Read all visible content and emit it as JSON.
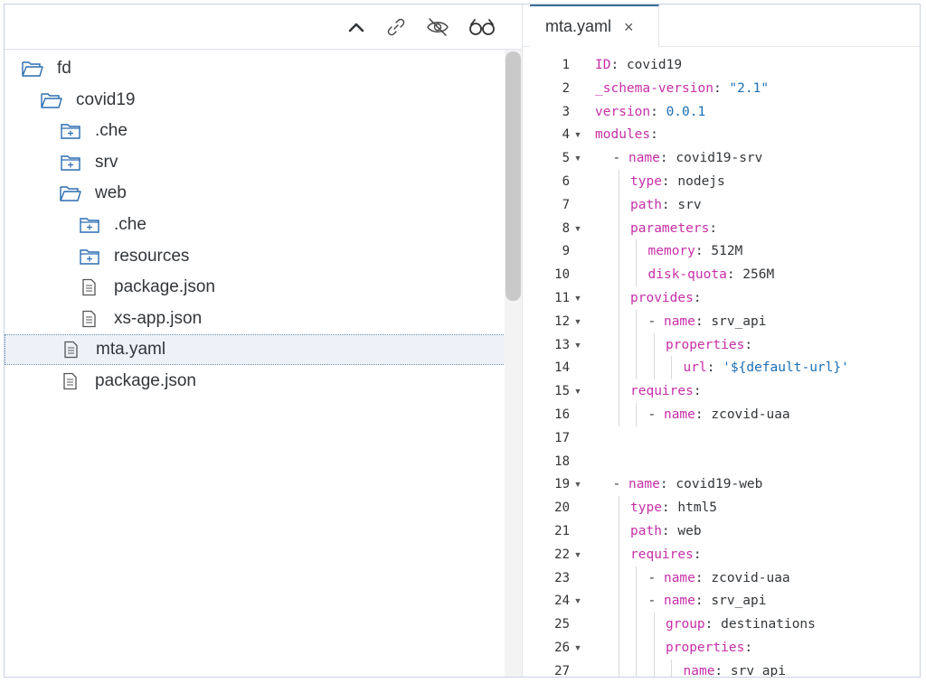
{
  "explorer": {
    "toolbar": {
      "icons": [
        "collapse-icon",
        "link-icon",
        "eye-off-icon",
        "glasses-icon"
      ]
    },
    "tree": [
      {
        "label": "fd",
        "type": "folder-open",
        "depth": 0
      },
      {
        "label": "covid19",
        "type": "folder-open",
        "depth": 1
      },
      {
        "label": ".che",
        "type": "folder",
        "depth": 2
      },
      {
        "label": "srv",
        "type": "folder",
        "depth": 2
      },
      {
        "label": "web",
        "type": "folder-open",
        "depth": 2
      },
      {
        "label": ".che",
        "type": "folder",
        "depth": 3
      },
      {
        "label": "resources",
        "type": "folder",
        "depth": 3
      },
      {
        "label": "package.json",
        "type": "file",
        "depth": 3
      },
      {
        "label": "xs-app.json",
        "type": "file",
        "depth": 3
      },
      {
        "label": "mta.yaml",
        "type": "file",
        "depth": 2,
        "selected": true
      },
      {
        "label": "package.json",
        "type": "file",
        "depth": 2
      }
    ]
  },
  "editor": {
    "tab": {
      "label": "mta.yaml",
      "close": "×"
    },
    "lines": [
      {
        "n": "1",
        "fold": false,
        "indent": 0,
        "key": "ID",
        "value": "covid19",
        "vtype": "plain"
      },
      {
        "n": "2",
        "fold": false,
        "indent": 0,
        "key": "_schema-version",
        "value": "\"2.1\"",
        "vtype": "string"
      },
      {
        "n": "3",
        "fold": false,
        "indent": 0,
        "key": "version",
        "value": "0.0.1",
        "vtype": "string"
      },
      {
        "n": "4",
        "fold": true,
        "indent": 0,
        "key": "modules",
        "value": "",
        "vtype": "plain"
      },
      {
        "n": "5",
        "fold": true,
        "indent": 1,
        "dash": true,
        "key": "name",
        "value": "covid19-srv",
        "vtype": "plain"
      },
      {
        "n": "6",
        "fold": false,
        "indent": 2,
        "key": "type",
        "value": "nodejs",
        "vtype": "plain"
      },
      {
        "n": "7",
        "fold": false,
        "indent": 2,
        "key": "path",
        "value": "srv",
        "vtype": "plain"
      },
      {
        "n": "8",
        "fold": true,
        "indent": 2,
        "key": "parameters",
        "value": "",
        "vtype": "plain"
      },
      {
        "n": "9",
        "fold": false,
        "indent": 3,
        "key": "memory",
        "value": "512M",
        "vtype": "plain"
      },
      {
        "n": "10",
        "fold": false,
        "indent": 3,
        "key": "disk-quota",
        "value": "256M",
        "vtype": "plain"
      },
      {
        "n": "11",
        "fold": true,
        "indent": 2,
        "key": "provides",
        "value": "",
        "vtype": "plain"
      },
      {
        "n": "12",
        "fold": true,
        "indent": 3,
        "dash": true,
        "key": "name",
        "value": "srv_api",
        "vtype": "plain"
      },
      {
        "n": "13",
        "fold": true,
        "indent": 4,
        "key": "properties",
        "value": "",
        "vtype": "plain"
      },
      {
        "n": "14",
        "fold": false,
        "indent": 5,
        "key": "url",
        "value": "'${default-url}'",
        "vtype": "string"
      },
      {
        "n": "15",
        "fold": true,
        "indent": 2,
        "key": "requires",
        "value": "",
        "vtype": "plain"
      },
      {
        "n": "16",
        "fold": false,
        "indent": 3,
        "dash": true,
        "key": "name",
        "value": "zcovid-uaa",
        "vtype": "plain"
      },
      {
        "n": "17",
        "fold": false,
        "indent": 0,
        "key": "",
        "value": "",
        "vtype": "plain"
      },
      {
        "n": "18",
        "fold": false,
        "indent": 0,
        "key": "",
        "value": "",
        "vtype": "plain"
      },
      {
        "n": "19",
        "fold": true,
        "indent": 1,
        "dash": true,
        "key": "name",
        "value": "covid19-web",
        "vtype": "plain"
      },
      {
        "n": "20",
        "fold": false,
        "indent": 2,
        "key": "type",
        "value": "html5",
        "vtype": "plain"
      },
      {
        "n": "21",
        "fold": false,
        "indent": 2,
        "key": "path",
        "value": "web",
        "vtype": "plain"
      },
      {
        "n": "22",
        "fold": true,
        "indent": 2,
        "key": "requires",
        "value": "",
        "vtype": "plain"
      },
      {
        "n": "23",
        "fold": false,
        "indent": 3,
        "dash": true,
        "key": "name",
        "value": "zcovid-uaa",
        "vtype": "plain"
      },
      {
        "n": "24",
        "fold": true,
        "indent": 3,
        "dash": true,
        "key": "name",
        "value": "srv_api",
        "vtype": "plain"
      },
      {
        "n": "25",
        "fold": false,
        "indent": 4,
        "key": "group",
        "value": "destinations",
        "vtype": "plain"
      },
      {
        "n": "26",
        "fold": true,
        "indent": 4,
        "key": "properties",
        "value": "",
        "vtype": "plain"
      },
      {
        "n": "27",
        "fold": false,
        "indent": 5,
        "key": "name",
        "value": "srv_api",
        "vtype": "plain"
      }
    ]
  }
}
